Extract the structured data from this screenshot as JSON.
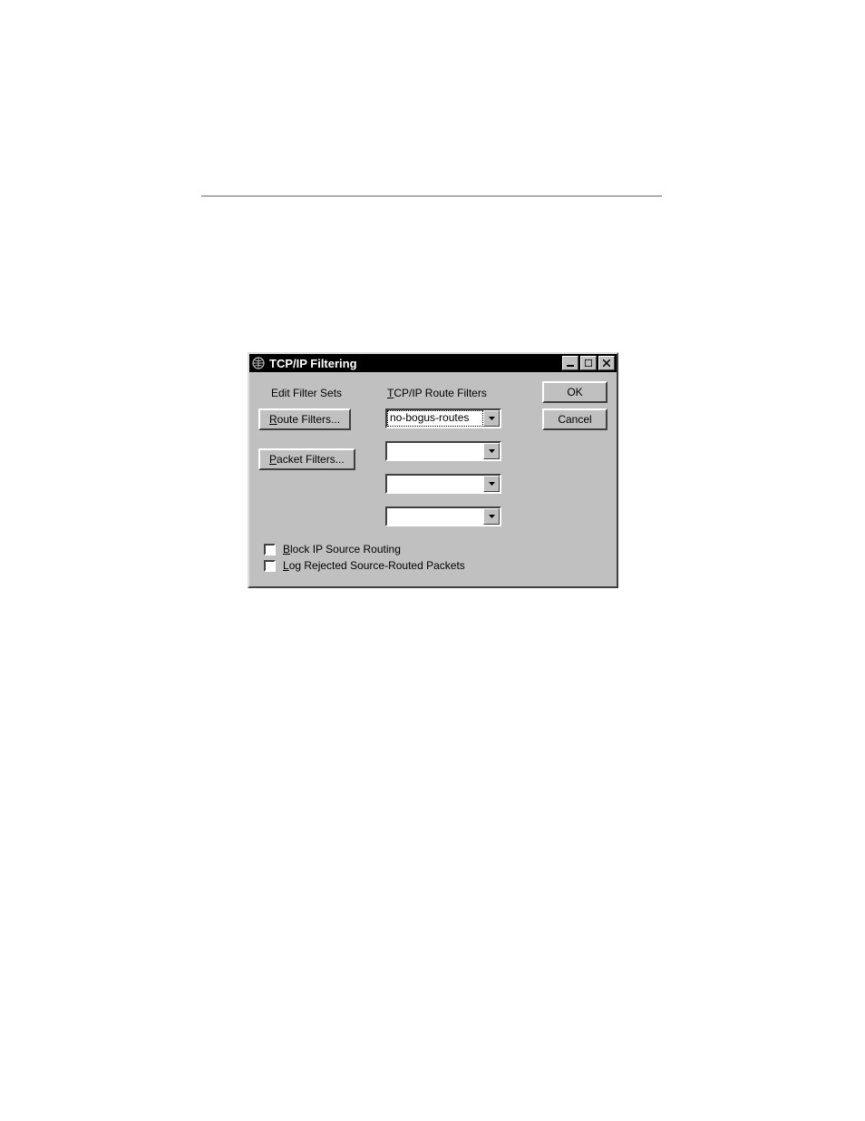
{
  "dialog": {
    "title": "TCP/IP Filtering",
    "sys_icon": "globe-icon",
    "window_buttons": {
      "minimize": "–",
      "maximize": "□",
      "close": "×"
    },
    "left": {
      "header": "Edit Filter Sets",
      "route_filters_btn": "Route Filters...",
      "route_filters_hotkey": "R",
      "packet_filters_btn": "Packet Filters...",
      "packet_filters_hotkey": "P"
    },
    "mid": {
      "header": "TCP/IP Route Filters",
      "header_hotkey": "T",
      "combos": [
        {
          "value": "no-bogus-routes",
          "selected": true
        },
        {
          "value": "",
          "selected": false
        },
        {
          "value": "",
          "selected": false
        },
        {
          "value": "",
          "selected": false
        }
      ]
    },
    "right": {
      "ok": "OK",
      "cancel": "Cancel"
    },
    "checkboxes": {
      "block": {
        "label": "Block IP Source Routing",
        "hotkey": "B",
        "checked": false
      },
      "log": {
        "label": "Log Rejected Source-Routed Packets",
        "hotkey": "L",
        "checked": false
      }
    }
  }
}
